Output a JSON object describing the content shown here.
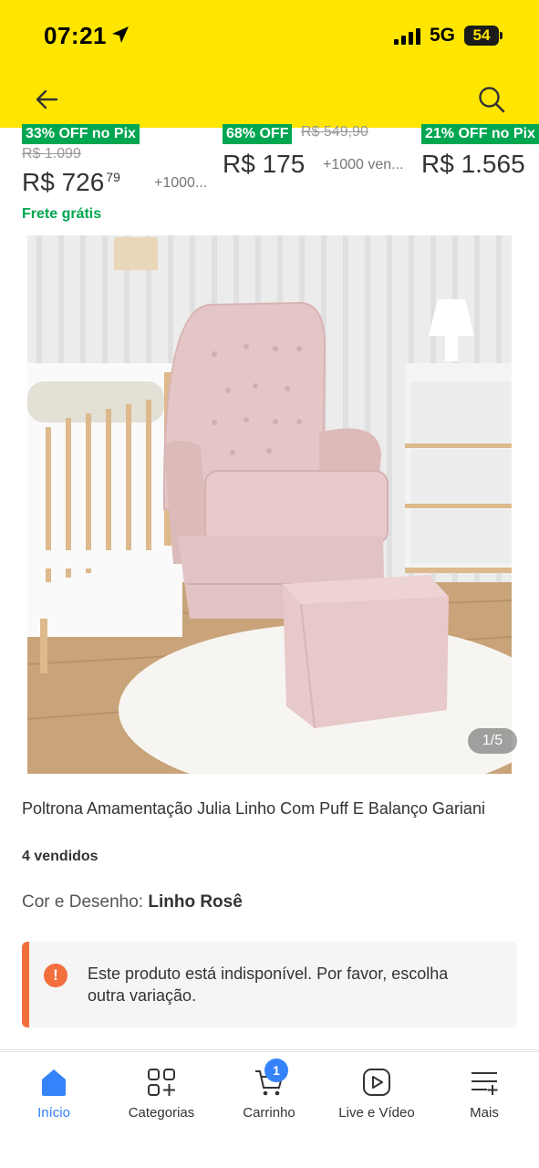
{
  "status_bar": {
    "time": "07:21",
    "network": "5G",
    "battery": "54"
  },
  "header": {
    "back_icon": "arrow-left-icon",
    "search_icon": "search-icon"
  },
  "carousel": [
    {
      "discount": "33% OFF no Pix",
      "old_price": "R$ 1.099",
      "price": "R$ 726",
      "cents": "79",
      "sold": "+1000...",
      "shipping": "Frete grátis"
    },
    {
      "discount": "68% OFF",
      "old_price": "R$ 549,90",
      "price": "R$ 175",
      "cents": "",
      "sold": "+1000 ven..."
    },
    {
      "discount": "21% OFF no Pix",
      "price": "R$ 1.565"
    }
  ],
  "product": {
    "image_counter": "1/5",
    "title": "Poltrona Amamentação Julia Linho Com Puff E Balanço Gariani",
    "sold": "4 vendidos",
    "variant_label": "Cor e Desenho:",
    "variant_value": "Linho Rosê"
  },
  "alert": {
    "icon": "!",
    "message": "Este produto está indisponível. Por favor, escolha outra variação."
  },
  "tabbar": {
    "items": [
      {
        "label": "Início",
        "icon": "home-icon",
        "active": true
      },
      {
        "label": "Categorias",
        "icon": "categories-icon"
      },
      {
        "label": "Carrinho",
        "icon": "cart-icon",
        "badge": "1"
      },
      {
        "label": "Live e Vídeo",
        "icon": "play-icon"
      },
      {
        "label": "Mais",
        "icon": "menu-plus-icon"
      }
    ]
  },
  "colors": {
    "brand_yellow": "#FFE600",
    "discount_green": "#00A650",
    "accent_blue": "#3483FA",
    "alert_orange": "#F26E3D"
  }
}
